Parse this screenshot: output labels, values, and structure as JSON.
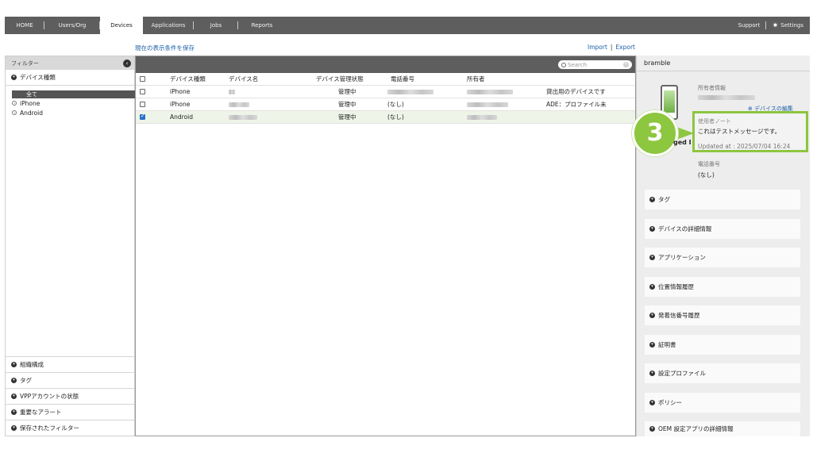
{
  "nav": {
    "items": [
      {
        "label": "HOME"
      },
      {
        "label": "Users/Org"
      },
      {
        "label": "Devices"
      },
      {
        "label": "Applications"
      },
      {
        "label": "Jobs"
      },
      {
        "label": "Reports"
      }
    ],
    "active": "Devices",
    "support": "Support",
    "settings": "Settings"
  },
  "toolbar": {
    "save_condition": "現在の表示条件を保存",
    "import": "Import",
    "separator": "|",
    "export": "Export"
  },
  "filter": {
    "title": "フィルター",
    "device_type_section": "デバイス種類",
    "options": [
      "全て",
      "iPhone",
      "Android"
    ],
    "selected": "全て",
    "bottom_sections": [
      "組織構成",
      "タグ",
      "VPPアカウントの状態",
      "重要なアラート",
      "保存されたフィルター"
    ]
  },
  "list": {
    "search_placeholder": "Search",
    "columns": [
      "デバイス種類",
      "デバイス名",
      "デバイス管理状態",
      "電話番号",
      "所有者"
    ],
    "rows": [
      {
        "type": "iPhone",
        "state": "管理中",
        "tel": "",
        "note": "貸出用のデバイスです",
        "checked": false
      },
      {
        "type": "iPhone",
        "state": "管理中",
        "tel": "(なし)",
        "note": "ADE：プロファイル未",
        "checked": false
      },
      {
        "type": "Android",
        "state": "管理中",
        "tel": "(なし)",
        "note": "",
        "checked": true
      }
    ]
  },
  "detail": {
    "title": "bramble",
    "owner_label": "所有者情報",
    "edit_link": "デバイスの編集",
    "device_label_partial": "ged I",
    "tel_label": "電話番号",
    "tel_value": "(なし)",
    "note": {
      "label": "使用者ノート",
      "message": "これはテストメッセージです。",
      "updated": "Updated at : 2025/07/04 16:24"
    },
    "callout_number": "3",
    "accordions": [
      "タグ",
      "デバイスの詳細情報",
      "アプリケーション",
      "位置情報履歴",
      "発着信番号履歴",
      "証明書",
      "設定プロファイル",
      "ポリシー",
      "OEM 設定アプリの詳細情報"
    ]
  },
  "colors": {
    "nav_bg": "#5e5e5e",
    "accent_green": "#8dc63f",
    "link_blue": "#1c5fa8",
    "checkbox_blue": "#2a72c9"
  }
}
